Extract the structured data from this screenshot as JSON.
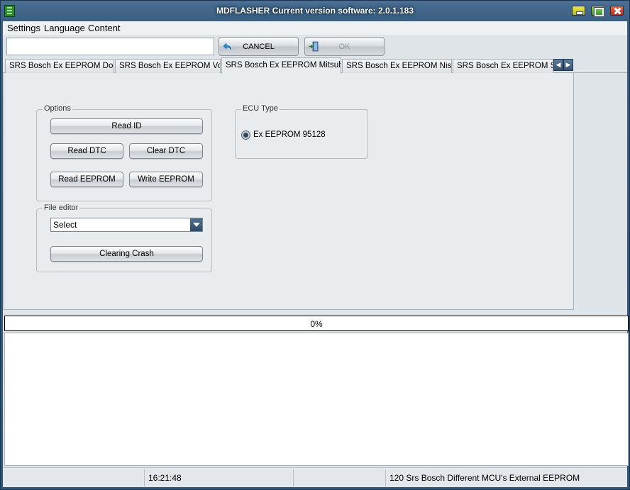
{
  "window": {
    "title": "MDFLASHER  Current version software: 2.0.1.183"
  },
  "menu": {
    "items": [
      "Settings",
      "Language",
      "Content"
    ]
  },
  "toolbar": {
    "input_value": "",
    "cancel_label": "CANCEL",
    "ok_label": "OK"
  },
  "tabs": {
    "items": [
      "SRS Bosch Ex EEPROM Dodge",
      "SRS Bosch Ex EEPROM Volvo",
      "SRS Bosch Ex EEPROM Mitsubishi",
      "SRS Bosch Ex EEPROM Nissan",
      "SRS Bosch Ex EEPROM Subaru"
    ],
    "active_index": 2
  },
  "options": {
    "title": "Options",
    "read_id": "Read ID",
    "read_dtc": "Read DTC",
    "clear_dtc": "Clear DTC",
    "read_eeprom": "Read EEPROM",
    "write_eeprom": "Write EEPROM"
  },
  "file_editor": {
    "title": "File editor",
    "select_value": "Select",
    "clearing_crash": "Clearing Crash"
  },
  "ecu_type": {
    "title": "ECU Type",
    "option": "Ex EEPROM 95128",
    "selected": true
  },
  "progress": {
    "value": 0,
    "text": "0%"
  },
  "status": {
    "cell1": "",
    "time": "16:21:48",
    "cell3": "",
    "description": "120 Srs Bosch Different MCU's External EEPROM"
  }
}
